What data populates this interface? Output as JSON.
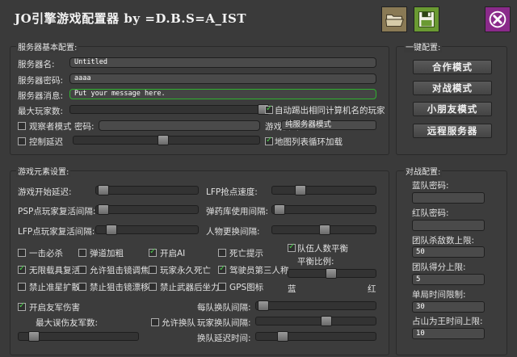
{
  "app": {
    "title": "JO引擎游戏配置器  by =D.B.S=A_IST",
    "open_icon": "folder-open-icon",
    "save_icon": "floppy-save-icon",
    "close_icon": "close-x-icon"
  },
  "server_panel": {
    "title": "服务器基本配置:",
    "server_name_label": "服务器名:",
    "server_name_value": "Untitled",
    "server_password_label": "服务器密码:",
    "server_password_value": "aaaa",
    "server_message_label": "服务器消息:",
    "server_message_value": "Put your message here.",
    "max_players_label": "最大玩家数:",
    "auto_kick_label": "自动踢出相同计算机名的玩家",
    "auto_kick_checked": true,
    "observer_mode_label": "观察者模式",
    "observer_mode_checked": false,
    "observer_password_label": "密码:",
    "game_mode_label": "游戏模式:",
    "game_mode_value": "纯服务器模式",
    "control_delay_label": "控制延迟",
    "control_delay_checked": false,
    "map_cycle_label": "地图列表循环加载",
    "map_cycle_checked": true
  },
  "quick_panel": {
    "title": "一键配置:",
    "buttons": [
      "合作模式",
      "对战模式",
      "小朋友模式",
      "远程服务器"
    ]
  },
  "elements_panel": {
    "title": "游戏元素设置:",
    "start_delay_label": "游戏开始延迟:",
    "lfp_speed_label": "LFP抢点速度:",
    "psp_respawn_label": "PSP点玩家复活间隔:",
    "ammo_interval_label": "弹药库使用间隔:",
    "lfp_respawn_label": "LFP点玩家复活间隔:",
    "char_change_label": "人物更换间隔:",
    "checkboxes": [
      {
        "label": "一击必杀",
        "checked": false
      },
      {
        "label": "弹道加粗",
        "checked": false
      },
      {
        "label": "开启AI",
        "checked": true
      },
      {
        "label": "死亡提示",
        "checked": false
      },
      {
        "label": "无限载具复活",
        "checked": true
      },
      {
        "label": "允许狙击镜调焦",
        "checked": false
      },
      {
        "label": "玩家永久死亡",
        "checked": false
      },
      {
        "label": "驾驶员第三人称",
        "checked": true
      },
      {
        "label": "禁止准星扩散",
        "checked": false
      },
      {
        "label": "禁止狙击镜漂移",
        "checked": false
      },
      {
        "label": "禁止武器后坐力",
        "checked": false
      },
      {
        "label": "GPS图标",
        "checked": false
      }
    ],
    "team_balance_label": "队伍人数平衡",
    "team_balance_checked": true,
    "balance_ratio_label": "平衡比例:",
    "blue_label": "蓝",
    "red_label": "红",
    "friendly_fire_label": "开启友军伤害",
    "friendly_fire_checked": true,
    "max_friendly_kills_label": "最大误伤友军数:",
    "team_swap_interval_label": "每队换队间隔:",
    "allow_swap_label": "允许换队",
    "allow_swap_checked": false,
    "player_swap_interval_label": "玩家换队间隔:",
    "swap_delay_label": "换队延迟时间:"
  },
  "battle_panel": {
    "title": "对战配置:",
    "blue_password_label": "蓝队密码:",
    "blue_password_value": "",
    "red_password_label": "红队密码:",
    "red_password_value": "",
    "kill_limit_label": "团队杀敌数上限:",
    "kill_limit_value": "50",
    "score_limit_label": "团队得分上限:",
    "score_limit_value": "5",
    "time_limit_label": "单局时间限制:",
    "time_limit_value": "30",
    "king_time_label": "占山为王时间上限:",
    "king_time_value": "10"
  }
}
